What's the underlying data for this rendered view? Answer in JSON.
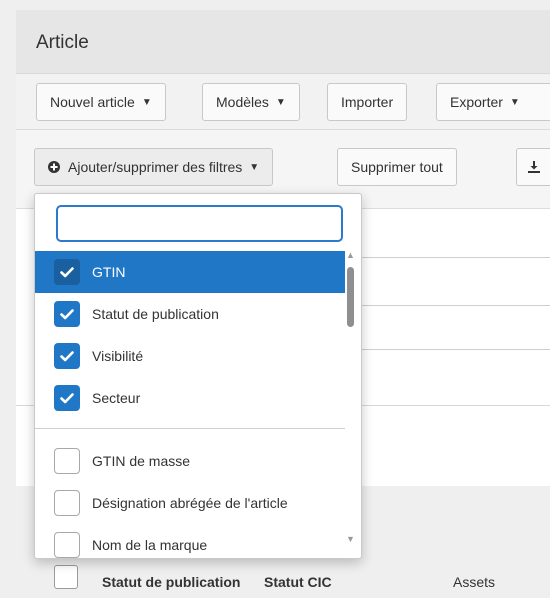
{
  "header": {
    "title": "Article"
  },
  "toolbar": {
    "new_article": "Nouvel article",
    "models": "Modèles",
    "import": "Importer",
    "export": "Exporter"
  },
  "filterbar": {
    "add_remove_filters": "Ajouter/supprimer des filtres",
    "clear_all": "Supprimer tout"
  },
  "dropdown": {
    "search_value": "",
    "selected": [
      {
        "label": "GTIN",
        "checked": true,
        "highlighted": true
      },
      {
        "label": "Statut de publication",
        "checked": true
      },
      {
        "label": "Visibilité",
        "checked": true
      },
      {
        "label": "Secteur",
        "checked": true
      }
    ],
    "available": [
      {
        "label": "GTIN de masse",
        "checked": false
      },
      {
        "label": "Désignation abrégée de l'article",
        "checked": false
      },
      {
        "label": "Nom de la marque",
        "checked": false
      }
    ]
  },
  "table": {
    "columns": [
      "Statut de publication",
      "Statut CIC",
      "Assets"
    ]
  },
  "colors": {
    "accent": "#1f77c6",
    "accent_dark": "#1a5f9f",
    "search_border": "#2c7ac9"
  },
  "icons": {
    "caret": "caret-down-icon",
    "filter": "plus-circle-icon",
    "download": "download-icon",
    "check": "check-icon"
  }
}
